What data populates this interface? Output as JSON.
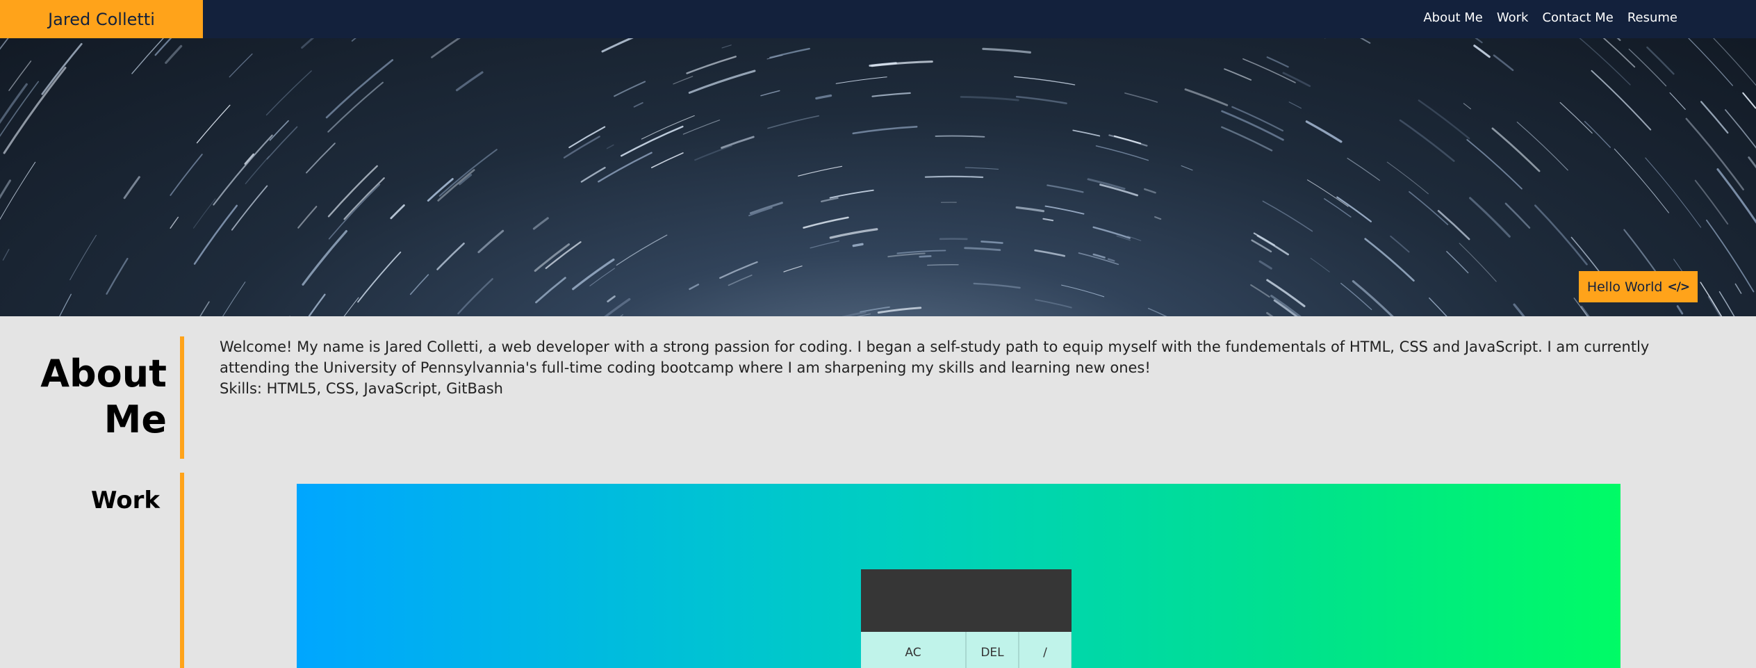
{
  "header": {
    "brand": "Jared Colletti",
    "nav": [
      "About Me",
      "Work",
      "Contact Me",
      "Resume"
    ]
  },
  "hero": {
    "button_label": "Hello World",
    "button_icon": "code-icon",
    "button_icon_glyph": "</>"
  },
  "about": {
    "title": "About Me",
    "paragraph": "Welcome! My name is Jared Colletti, a web developer with a strong passion for coding. I began a self-study path to equip myself with the fundementals of HTML, CSS and JavaScript. I am currently attending the University of Pennsylvannia's full-time coding bootcamp where I am sharpening my skills and learning new ones!",
    "skills": "Skills: HTML5, CSS, JavaScript, GitBash"
  },
  "work": {
    "title": "Work",
    "calculator_keys": [
      "AC",
      "DEL",
      "/"
    ]
  },
  "colors": {
    "accent": "#ffa31a",
    "navbar": "#13213c",
    "page_background": "#e4e4e4"
  }
}
